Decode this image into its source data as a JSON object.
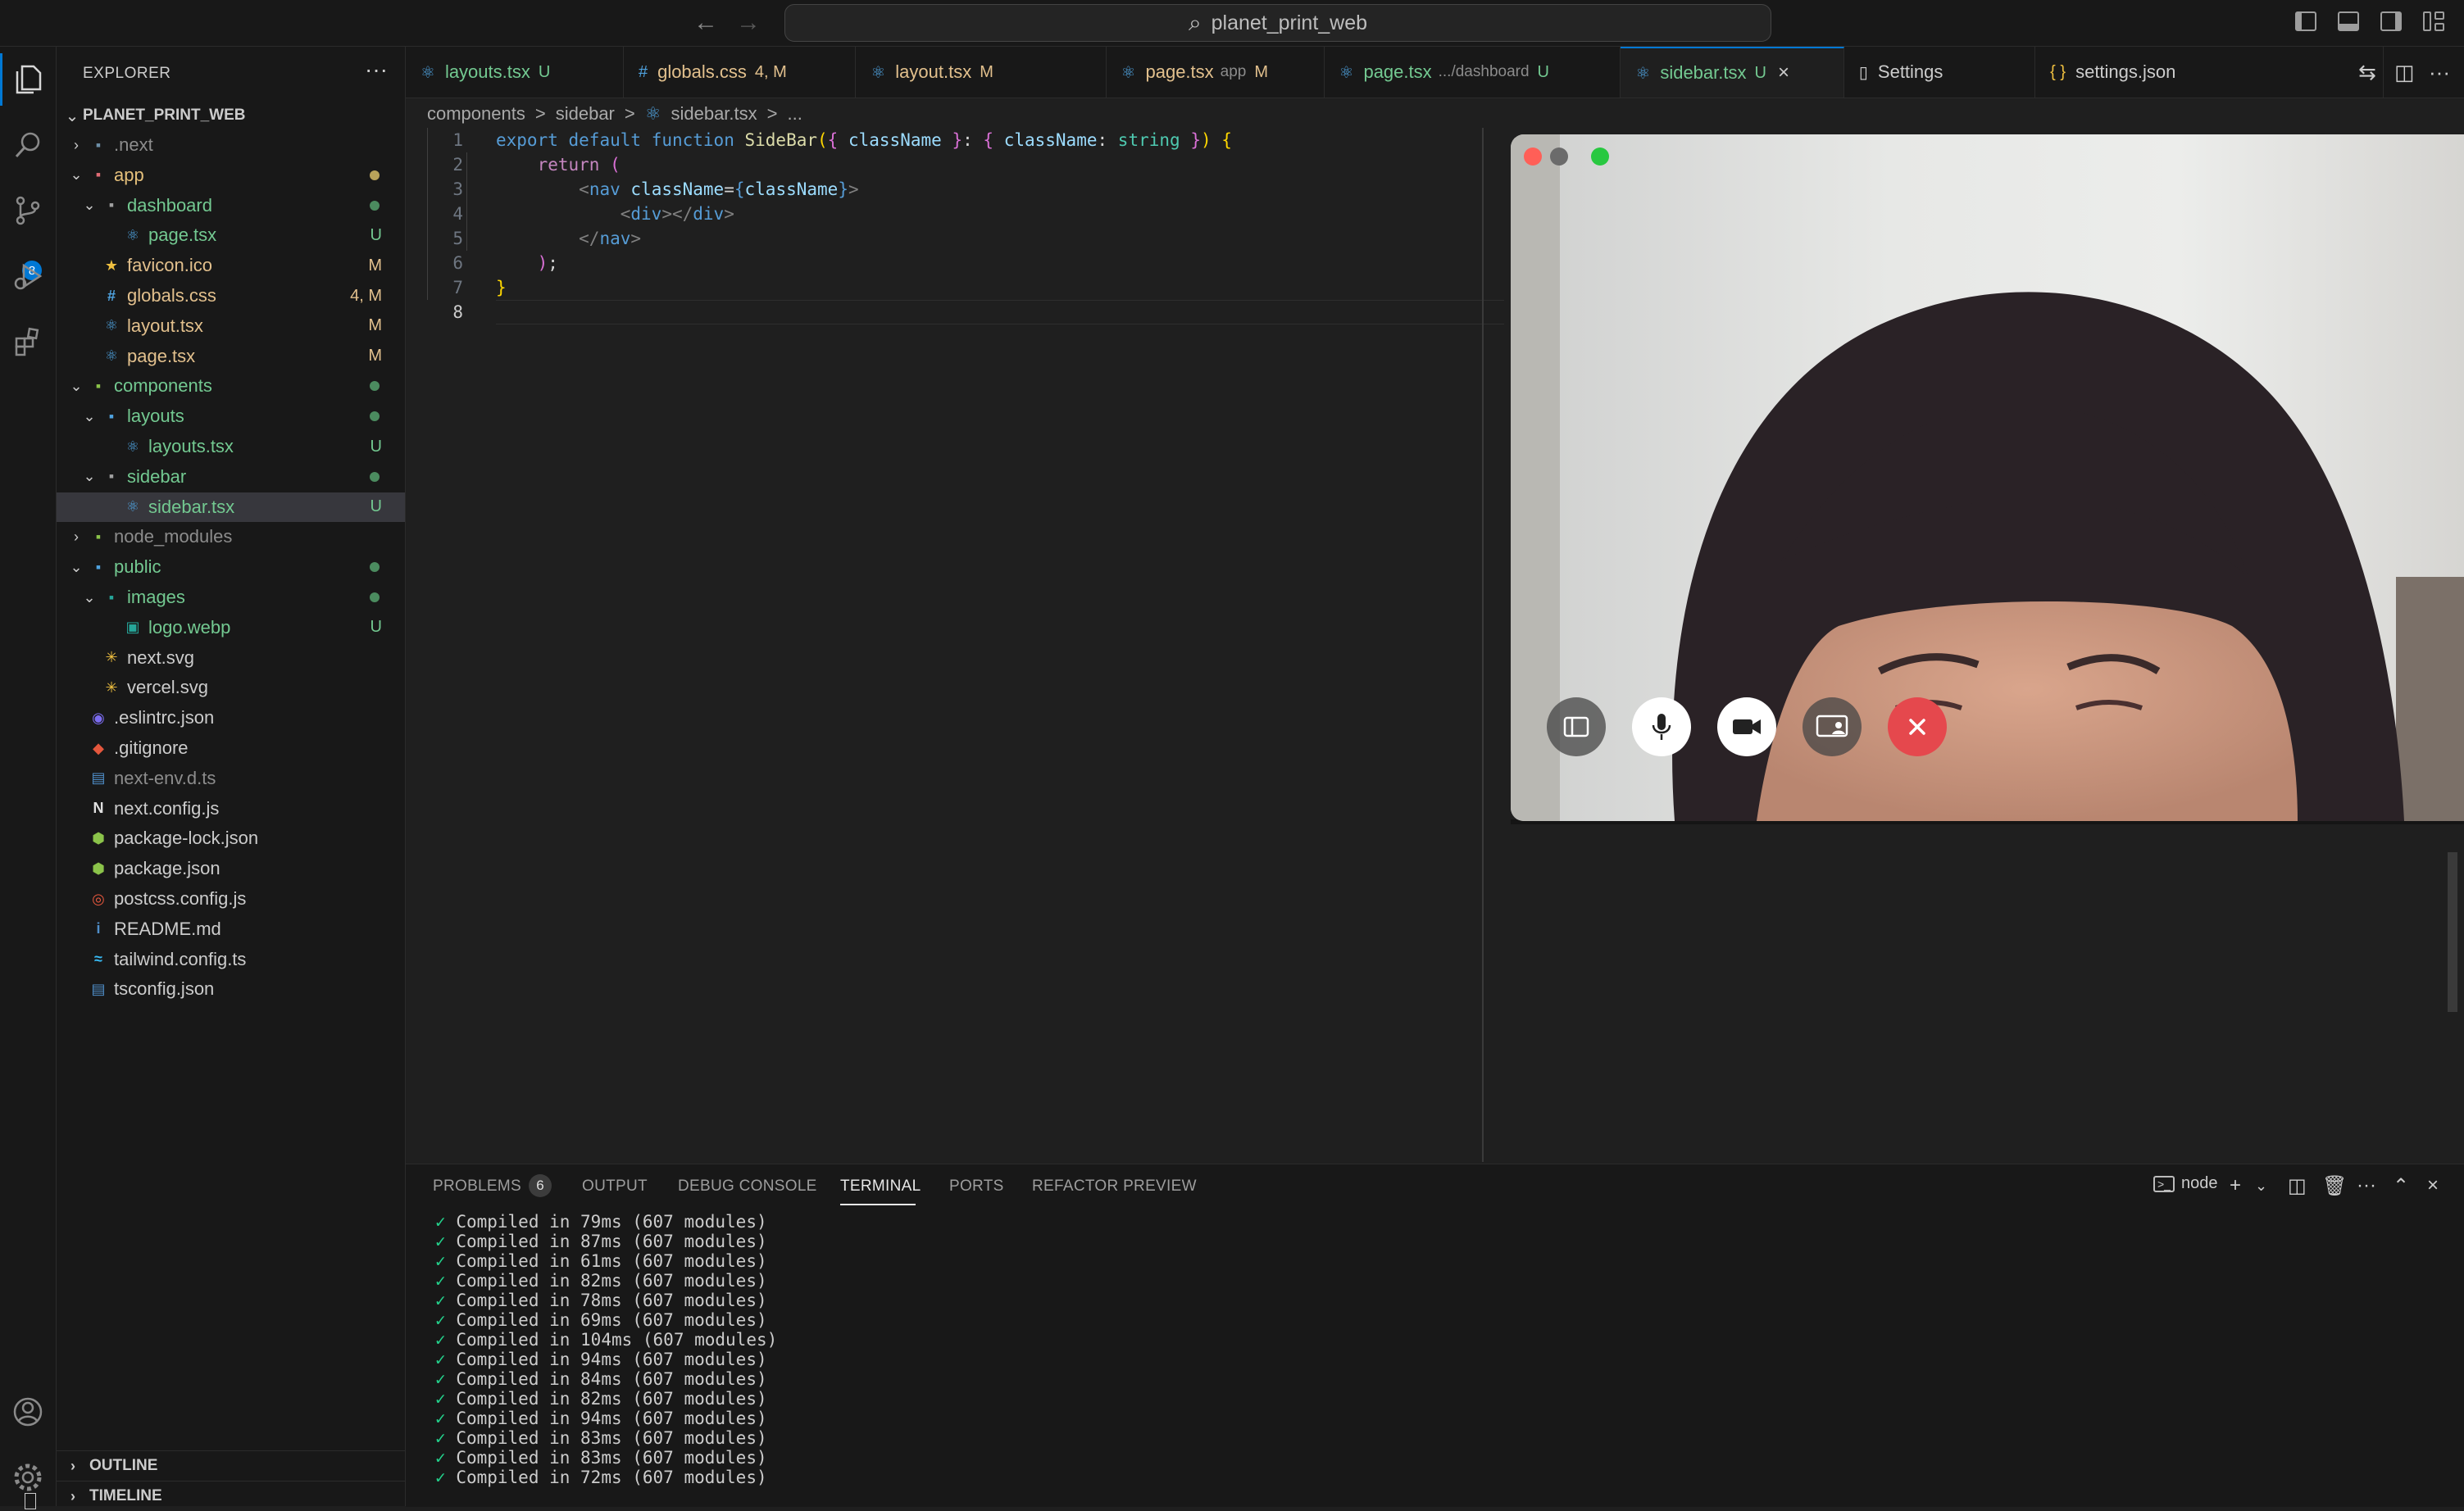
{
  "titlebar": {
    "back": "←",
    "forward": "→",
    "search_icon": "⌕",
    "project_title": "planet_print_web"
  },
  "activity": {
    "source_control_badge": "8"
  },
  "explorer": {
    "title": "EXPLORER",
    "more": "···",
    "project": "PLANET_PRINT_WEB",
    "tree": [
      {
        "label": ".next",
        "chev": "›",
        "icon": "folder-icon",
        "glyph": "▪",
        "color": "#8c8c8c",
        "iconColor": "#6d8fa8",
        "depth": 1,
        "dot": ""
      },
      {
        "label": "app",
        "chev": "⌄",
        "icon": "folder-open-icon",
        "glyph": "▪",
        "color": "#e5c07b",
        "iconColor": "#e06c75",
        "depth": 1,
        "dot": "#b8a25a"
      },
      {
        "label": "dashboard",
        "chev": "⌄",
        "icon": "folder-open-icon",
        "glyph": "▪",
        "color": "#73c991",
        "iconColor": "#a0a0a0",
        "depth": 2,
        "dot": "#4b8b5f"
      },
      {
        "label": "page.tsx",
        "chev": "",
        "icon": "react-icon",
        "glyph": "⚛",
        "color": "#73c991",
        "iconColor": "#4fa3e0",
        "depth": 3,
        "badge": "U",
        "badgeColor": "#73c991"
      },
      {
        "label": "favicon.ico",
        "chev": "",
        "icon": "star-icon",
        "glyph": "★",
        "color": "#e2c08d",
        "iconColor": "#f0c040",
        "depth": 2,
        "badge": "M",
        "badgeColor": "#e2c08d"
      },
      {
        "label": "globals.css",
        "chev": "",
        "icon": "css-icon",
        "glyph": "#",
        "color": "#e2c08d",
        "iconColor": "#4fa3e0",
        "depth": 2,
        "badge": "4, M",
        "badgeColor": "#e2c08d"
      },
      {
        "label": "layout.tsx",
        "chev": "",
        "icon": "react-icon",
        "glyph": "⚛",
        "color": "#e2c08d",
        "iconColor": "#4fa3e0",
        "depth": 2,
        "badge": "M",
        "badgeColor": "#e2c08d"
      },
      {
        "label": "page.tsx",
        "chev": "",
        "icon": "react-icon",
        "glyph": "⚛",
        "color": "#e2c08d",
        "iconColor": "#4fa3e0",
        "depth": 2,
        "badge": "M",
        "badgeColor": "#e2c08d"
      },
      {
        "label": "components",
        "chev": "⌄",
        "icon": "folder-open-icon",
        "glyph": "▪",
        "color": "#73c991",
        "iconColor": "#8bc34a",
        "depth": 1,
        "dot": "#4b8b5f"
      },
      {
        "label": "layouts",
        "chev": "⌄",
        "icon": "folder-open-icon",
        "glyph": "▪",
        "color": "#73c991",
        "iconColor": "#4fa3e0",
        "depth": 2,
        "dot": "#4b8b5f"
      },
      {
        "label": "layouts.tsx",
        "chev": "",
        "icon": "react-icon",
        "glyph": "⚛",
        "color": "#73c991",
        "iconColor": "#4fa3e0",
        "depth": 3,
        "badge": "U",
        "badgeColor": "#73c991"
      },
      {
        "label": "sidebar",
        "chev": "⌄",
        "icon": "folder-open-icon",
        "glyph": "▪",
        "color": "#73c991",
        "iconColor": "#a0a0a0",
        "depth": 2,
        "dot": "#4b8b5f"
      },
      {
        "label": "sidebar.tsx",
        "chev": "",
        "icon": "react-icon",
        "glyph": "⚛",
        "color": "#73c991",
        "iconColor": "#4fa3e0",
        "depth": 3,
        "badge": "U",
        "badgeColor": "#73c991",
        "selected": true
      },
      {
        "label": "node_modules",
        "chev": "›",
        "icon": "folder-icon",
        "glyph": "▪",
        "color": "#8c8c8c",
        "iconColor": "#8bc34a",
        "depth": 1,
        "dot": ""
      },
      {
        "label": "public",
        "chev": "⌄",
        "icon": "folder-open-icon",
        "glyph": "▪",
        "color": "#73c991",
        "iconColor": "#4fa3e0",
        "depth": 1,
        "dot": "#4b8b5f"
      },
      {
        "label": "images",
        "chev": "⌄",
        "icon": "folder-open-icon",
        "glyph": "▪",
        "color": "#73c991",
        "iconColor": "#26a69a",
        "depth": 2,
        "dot": "#4b8b5f"
      },
      {
        "label": "logo.webp",
        "chev": "",
        "icon": "image-icon",
        "glyph": "▣",
        "color": "#73c991",
        "iconColor": "#26a69a",
        "depth": 3,
        "badge": "U",
        "badgeColor": "#73c991"
      },
      {
        "label": "next.svg",
        "chev": "",
        "icon": "svg-icon",
        "glyph": "✳",
        "color": "#cccccc",
        "iconColor": "#f0c040",
        "depth": 2
      },
      {
        "label": "vercel.svg",
        "chev": "",
        "icon": "svg-icon",
        "glyph": "✳",
        "color": "#cccccc",
        "iconColor": "#f0c040",
        "depth": 2
      },
      {
        "label": ".eslintrc.json",
        "chev": "",
        "icon": "eslint-icon",
        "glyph": "◉",
        "color": "#cccccc",
        "iconColor": "#7c6cf0",
        "depth": 1
      },
      {
        "label": ".gitignore",
        "chev": "",
        "icon": "git-icon",
        "glyph": "◆",
        "color": "#cccccc",
        "iconColor": "#e4573d",
        "depth": 1
      },
      {
        "label": "next-env.d.ts",
        "chev": "",
        "icon": "typescript-icon",
        "glyph": "▤",
        "color": "#8c8c8c",
        "iconColor": "#4f8ec9",
        "depth": 1
      },
      {
        "label": "next.config.js",
        "chev": "",
        "icon": "nextjs-icon",
        "glyph": "N",
        "color": "#cccccc",
        "iconColor": "#e0e0e0",
        "depth": 1
      },
      {
        "label": "package-lock.json",
        "chev": "",
        "icon": "npm-icon",
        "glyph": "⬢",
        "color": "#cccccc",
        "iconColor": "#8bc34a",
        "depth": 1
      },
      {
        "label": "package.json",
        "chev": "",
        "icon": "npm-icon",
        "glyph": "⬢",
        "color": "#cccccc",
        "iconColor": "#8bc34a",
        "depth": 1
      },
      {
        "label": "postcss.config.js",
        "chev": "",
        "icon": "postcss-icon",
        "glyph": "◎",
        "color": "#cccccc",
        "iconColor": "#e4573d",
        "depth": 1
      },
      {
        "label": "README.md",
        "chev": "",
        "icon": "info-icon",
        "glyph": "i",
        "color": "#cccccc",
        "iconColor": "#4f8ec9",
        "depth": 1
      },
      {
        "label": "tailwind.config.ts",
        "chev": "",
        "icon": "tailwind-icon",
        "glyph": "≈",
        "color": "#cccccc",
        "iconColor": "#38bdf8",
        "depth": 1
      },
      {
        "label": "tsconfig.json",
        "chev": "",
        "icon": "typescript-icon",
        "glyph": "▤",
        "color": "#cccccc",
        "iconColor": "#4f8ec9",
        "depth": 1
      }
    ],
    "outline": "OUTLINE",
    "timeline": "TIMELINE"
  },
  "tabs": [
    {
      "label": "layouts.tsx",
      "sub": "",
      "status": "U",
      "statusColor": "#73c991",
      "color": "#73c991",
      "icon": "react-icon",
      "glyph": "⚛",
      "iconColor": "#4fa3e0"
    },
    {
      "label": "globals.css",
      "sub": "",
      "status": "4, M",
      "statusColor": "#e2c08d",
      "color": "#e2c08d",
      "icon": "css-icon",
      "glyph": "#",
      "iconColor": "#4fa3e0"
    },
    {
      "label": "layout.tsx",
      "sub": "",
      "status": "M",
      "statusColor": "#e2c08d",
      "color": "#e2c08d",
      "icon": "react-icon",
      "glyph": "⚛",
      "iconColor": "#4fa3e0"
    },
    {
      "label": "page.tsx",
      "sub": "app",
      "status": "M",
      "statusColor": "#e2c08d",
      "color": "#e2c08d",
      "icon": "react-icon",
      "glyph": "⚛",
      "iconColor": "#4fa3e0"
    },
    {
      "label": "page.tsx",
      "sub": ".../dashboard",
      "status": "U",
      "statusColor": "#73c991",
      "color": "#73c991",
      "icon": "react-icon",
      "glyph": "⚛",
      "iconColor": "#4fa3e0"
    },
    {
      "label": "sidebar.tsx",
      "sub": "",
      "status": "U",
      "statusColor": "#73c991",
      "color": "#73c991",
      "icon": "react-icon",
      "glyph": "⚛",
      "iconColor": "#4fa3e0",
      "active": true,
      "close": "×"
    },
    {
      "label": "Settings",
      "sub": "",
      "status": "",
      "statusColor": "#cccccc",
      "color": "#cccccc",
      "icon": "file-icon",
      "glyph": "▯",
      "iconColor": "#cccccc"
    },
    {
      "label": "settings.json",
      "sub": "",
      "status": "",
      "statusColor": "#cccccc",
      "color": "#cccccc",
      "icon": "json-icon",
      "glyph": "{ }",
      "iconColor": "#f0c040"
    }
  ],
  "breadcrumb": {
    "part1": "components",
    "part2": "sidebar",
    "part3": "sidebar.tsx",
    "sep": ">",
    "more": "..."
  },
  "editor": {
    "line_numbers": [
      "1",
      "2",
      "3",
      "4",
      "5",
      "6",
      "7",
      "8"
    ],
    "code": {
      "l1_export": "export",
      "l1_default": "default",
      "l1_function": "function",
      "l1_name": "SideBar",
      "l1_param": "className",
      "l1_type_key": "className",
      "l1_type": "string",
      "l2_return": "return",
      "l3_tag": "nav",
      "l3_attr": "className",
      "l3_val": "className",
      "l4_tag": "div",
      "l5_tag": "nav"
    }
  },
  "facetime": {
    "controls": [
      "sidebar-toggle",
      "microphone",
      "camera",
      "screen-share",
      "end-call"
    ]
  },
  "panel": {
    "tabs": {
      "problems": "PROBLEMS",
      "output": "OUTPUT",
      "debug": "DEBUG CONSOLE",
      "terminal": "TERMINAL",
      "ports": "PORTS",
      "refactor": "REFACTOR PREVIEW"
    },
    "problems_count": "6",
    "terminal_name": "node",
    "terminal_lines": [
      "Compiled in 79ms (607 modules)",
      "Compiled in 87ms (607 modules)",
      "Compiled in 61ms (607 modules)",
      "Compiled in 82ms (607 modules)",
      "Compiled in 78ms (607 modules)",
      "Compiled in 69ms (607 modules)",
      "Compiled in 104ms (607 modules)",
      "Compiled in 94ms (607 modules)",
      "Compiled in 84ms (607 modules)",
      "Compiled in 82ms (607 modules)",
      "Compiled in 94ms (607 modules)",
      "Compiled in 83ms (607 modules)",
      "Compiled in 83ms (607 modules)",
      "Compiled in 72ms (607 modules)"
    ],
    "check": "✓"
  },
  "colors": {
    "accent": "#0078d4",
    "untracked": "#73c991",
    "modified": "#e2c08d",
    "end_call": "#e5484d"
  }
}
